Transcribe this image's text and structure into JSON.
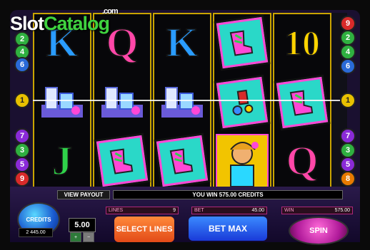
{
  "watermark": {
    "brand_a": "Slot",
    "brand_b": "Catalog",
    "domain": ".com"
  },
  "reels": [
    [
      "K",
      "perfume",
      "J"
    ],
    [
      "Q",
      "perfume",
      "card"
    ],
    [
      "K",
      "perfume",
      "card"
    ],
    [
      "card",
      "card",
      "lady"
    ],
    [
      "10",
      "card",
      "Q"
    ]
  ],
  "left_line_numbers": [
    "2",
    "4",
    "6",
    "1",
    "7",
    "3",
    "5",
    "9"
  ],
  "right_line_numbers": [
    "9",
    "2",
    "4",
    "6",
    "1",
    "7",
    "3",
    "5",
    "8"
  ],
  "left_top_number": "2",
  "view_payout_label": "VIEW PAYOUT",
  "win_message": "YOU WIN 575.00 CREDITS",
  "credits": {
    "label": "CREDITS",
    "value": "2 445.00"
  },
  "lines": {
    "label": "LINES",
    "value": "9"
  },
  "bet": {
    "label": "BET",
    "value": "45.00"
  },
  "win": {
    "label": "WIN",
    "value": "575.00"
  },
  "coin_value": "5.00",
  "buttons": {
    "select_lines": "SELECT LINES",
    "bet_max": "BET MAX",
    "spin": "SPIN"
  },
  "colors": {
    "reel_border": "#c9a400",
    "letter_K": "#2a9cff",
    "letter_Q": "#ff47a8",
    "letter_J": "#2fd24a",
    "letter_10": "#ffd400",
    "accent_pink": "#ff47d6"
  }
}
